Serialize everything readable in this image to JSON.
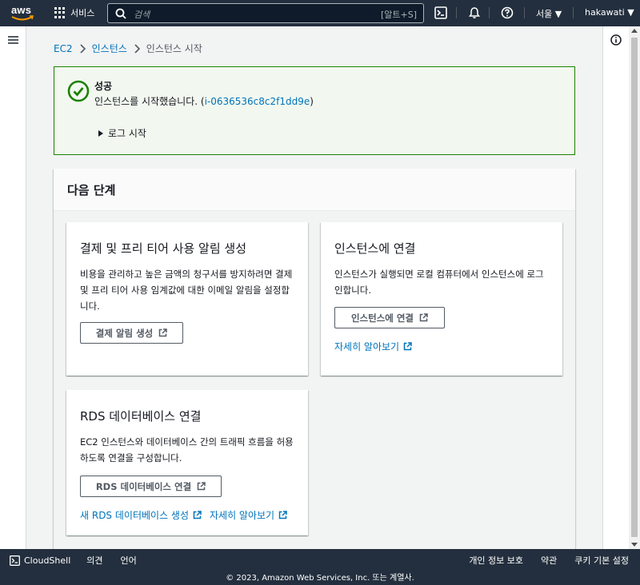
{
  "topnav": {
    "logo": "aws",
    "services_label": "서비스",
    "search_placeholder": "검색",
    "search_shortcut": "[알트+S]",
    "region": "서울 ▼",
    "user": "hakawati ▼"
  },
  "breadcrumb": {
    "items": [
      "EC2",
      "인스턴스",
      "인스턴스 시작"
    ]
  },
  "flash": {
    "title": "성공",
    "message_prefix": "인스턴스를 시작했습니다. (",
    "instance_id": "i-0636536c8c2f1dd9e",
    "message_suffix": ")",
    "log_label": "로그 시작"
  },
  "next_steps": {
    "title": "다음 단계",
    "billing": {
      "title": "결제 및 프리 티어 사용 알림 생성",
      "desc": "비용을 관리하고 높은 금액의 청구서를 방지하려면 결제 및 프리 티어 사용 임계값에 대한 이메일 알림을 설정합니다.",
      "button": "결제 알림 생성"
    },
    "connect": {
      "title": "인스턴스에 연결",
      "desc": "인스턴스가 실행되면 로컬 컴퓨터에서 인스턴스에 로그인합니다.",
      "button": "인스턴스에 연결",
      "learn_more": "자세히 알아보기"
    },
    "rds": {
      "title": "RDS 데이터베이스 연결",
      "desc": "EC2 인스턴스와 데이터베이스 간의 트래픽 흐름을 허용하도록 연결을 구성합니다.",
      "button": "RDS 데이터베이스 연결",
      "new_rds": "새 RDS 데이터베이스 생성",
      "learn_more": "자세히 알아보기"
    }
  },
  "footer": {
    "cloudshell": "CloudShell",
    "feedback": "의견",
    "language": "언어",
    "privacy": "개인 정보 보호",
    "terms": "약관",
    "cookies": "쿠키 기본 설정",
    "copyright": "© 2023, Amazon Web Services, Inc. 또는 계열사."
  },
  "colors": {
    "nav_bg": "#232f3e",
    "link": "#0073bb",
    "success": "#1d8102",
    "success_bg": "#f2f8f0"
  }
}
